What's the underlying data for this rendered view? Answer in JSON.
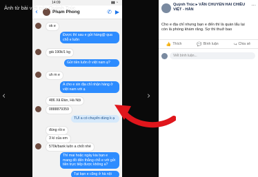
{
  "viewer": {
    "title": "Ảnh từ bài viết của Quỳnh Trúc",
    "prev_glyph": "‹",
    "next_glyph": "›"
  },
  "phone": {
    "status_time": "14:09",
    "status_right": "▮▮ ◔",
    "contact_name": "Phạm Phong",
    "back_glyph": "‹",
    "messages": [
      {
        "side": "recv",
        "text": "ok e"
      },
      {
        "side": "sent",
        "text": "Được thì sau e gửi hàng@ qua chỗ e luôn"
      },
      {
        "side": "recv",
        "text": "giá 190k/1 kg"
      },
      {
        "side": "sent",
        "text": "Gửi tiền luôn ở việt nam ạ?"
      },
      {
        "side": "recv",
        "text": "uh m e"
      },
      {
        "side": "sent",
        "text": "A cho e xin địa chỉ nhận hàng ở việt nam với ạ"
      },
      {
        "side": "recv",
        "text": "486 Xã Đàn, Hà Nội"
      },
      {
        "side": "recv",
        "text": "0888879359"
      },
      {
        "side": "sent",
        "text": "TUI a có chuyển dùng k ạ"
      },
      {
        "side": "recv",
        "text": "đúng rồi e"
      },
      {
        "side": "recv",
        "text": "3 kí của em"
      },
      {
        "side": "recv",
        "text": "570k/bank luôn a chốt nhé"
      },
      {
        "side": "sent",
        "text": "Thì mai hoặc ngày kia bạn e mang đồ đến thẳng chỗ e với gửi tiền trực tiếp được không a?"
      },
      {
        "side": "sent",
        "text": "Tại bạn e cũng ở hà nội"
      }
    ]
  },
  "fb": {
    "title": "Quỳnh Trúc ▸ VĂN CHUYỂN HAI CHIỀU VIỆT - HÀN",
    "menu_glyph": "···",
    "text": "Cho e địa chỉ nhưng bạn e đến thì là quán lẩu lại còn là phòng khám răng. Sợ thì thuở bao",
    "actions": [
      {
        "label": "Thích",
        "icon": "👍"
      },
      {
        "label": "Bình luận",
        "icon": "💬"
      },
      {
        "label": "Chia sẻ",
        "icon": "↪"
      }
    ],
    "comment_placeholder": "Viết bình luận..."
  },
  "colors": {
    "sent_bubble": "#2d8cff",
    "annotation_arrow": "#e0161c",
    "fb_title": "#1c2b4a"
  }
}
